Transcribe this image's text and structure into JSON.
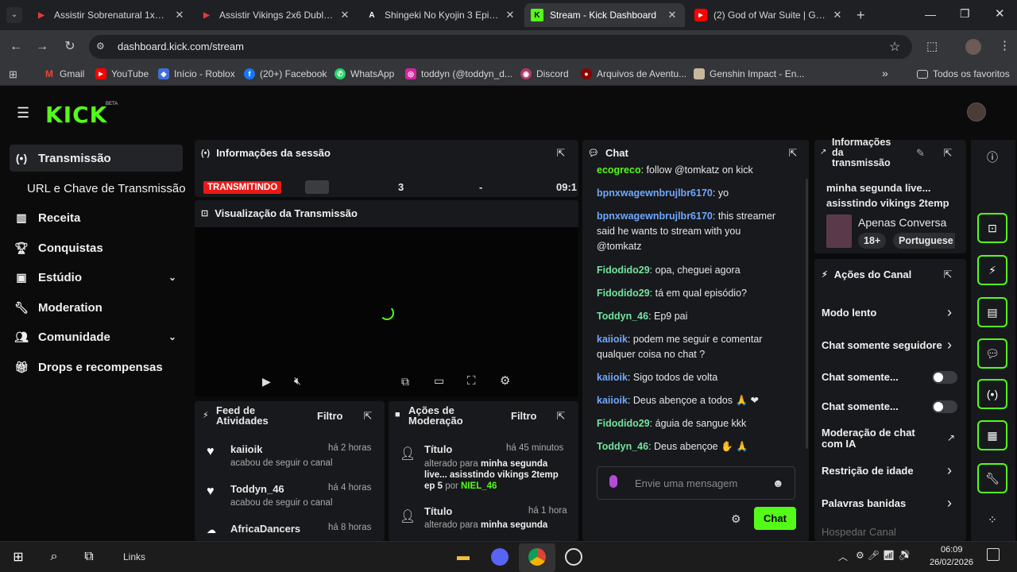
{
  "browser": {
    "tabs": [
      {
        "title": "Assistir Sobrenatural 1x10 Du",
        "favicon": "AS"
      },
      {
        "title": "Assistir Vikings 2x6 Dublado",
        "favicon": "AS"
      },
      {
        "title": "Shingeki No Kyojin 3 Episod",
        "favicon": "A"
      },
      {
        "title": "Stream - Kick Dashboard",
        "favicon": "K"
      },
      {
        "title": "(2) God of War Suite | God of",
        "favicon": "YT"
      }
    ],
    "new_tab": "+",
    "url": "dashboard.kick.com/stream",
    "bookmarks": [
      "Gmail",
      "YouTube",
      "Início - Roblox",
      "(20+) Facebook",
      "WhatsApp",
      "toddyn (@toddyn_d...",
      "Discord",
      "Arquivos de Aventu...",
      "Genshin Impact - En..."
    ],
    "bookmarks_overflow": "»",
    "all_favorites": "Todos os favoritos"
  },
  "kick": {
    "logo": "KICK",
    "beta": "BETA",
    "sidebar": [
      {
        "label": "Transmissão",
        "icon": "broadcast-icon"
      },
      {
        "label": "URL e Chave de Transmissão",
        "icon": ""
      },
      {
        "label": "Receita",
        "icon": "chart-icon"
      },
      {
        "label": "Conquistas",
        "icon": "trophy-icon"
      },
      {
        "label": "Estúdio",
        "icon": "studio-icon"
      },
      {
        "label": "Moderation",
        "icon": "wrench-icon"
      },
      {
        "label": "Comunidade",
        "icon": "community-icon"
      },
      {
        "label": "Drops e recompensas",
        "icon": "gift-icon"
      }
    ],
    "session": {
      "title": "Informações da sessão",
      "status": "TRANSMITINDO",
      "viewers": "3",
      "followers": "-",
      "time": "09:1"
    },
    "preview": {
      "title": "Visualização da Transmissão"
    },
    "feed": {
      "title": "Feed de Atividades",
      "filter": "Filtro",
      "items": [
        {
          "user": "kaiioik",
          "time": "há 2 horas",
          "desc": "acabou de seguir o canal"
        },
        {
          "user": "Toddyn_46",
          "time": "há 4 horas",
          "desc": "acabou de seguir o canal"
        },
        {
          "user": "AfricaDancers",
          "time": "há 8 horas",
          "desc": ""
        }
      ]
    },
    "moderation": {
      "title": "Ações de Moderação",
      "filter": "Filtro",
      "items": [
        {
          "title": "Título",
          "time": "há 45 minutos",
          "altered": "alterado para",
          "value": "minha segunda live... asisstindo vikings 2temp ep 5",
          "by": "por",
          "mod": "NIEL_46"
        },
        {
          "title": "Título",
          "time": "há 1 hora",
          "altered": "alterado para",
          "value": "minha segunda",
          "by": "",
          "mod": ""
        }
      ]
    },
    "chat": {
      "title": "Chat",
      "messages": [
        {
          "user": "ecogreco",
          "text": "follow @tomkatz on kick",
          "color": "#53fc18"
        },
        {
          "user": "bpnxwagewnbrujlbr6170",
          "text": "yo",
          "color": "#6fa8ff"
        },
        {
          "user": "bpnxwagewnbrujlbr6170",
          "text": "this streamer said he wants to stream with you @tomkatz",
          "color": "#6fa8ff"
        },
        {
          "user": "Fidodido29",
          "text": "opa, cheguei agora",
          "color": "#72e4a0"
        },
        {
          "user": "Fidodido29",
          "text": "tá em qual episódio?",
          "color": "#72e4a0"
        },
        {
          "user": "Toddyn_46",
          "text": "Ep9 pai",
          "color": "#72e4a0"
        },
        {
          "user": "kaiioik",
          "text": "podem me seguir e comentar qualquer coisa no chat ?",
          "color": "#6fa8ff"
        },
        {
          "user": "kaiioik",
          "text": "Sigo todos de volta",
          "color": "#6fa8ff"
        },
        {
          "user": "kaiioik",
          "text": "Deus abençoe a todos 🙏 ❤",
          "color": "#6fa8ff"
        },
        {
          "user": "Fidodido29",
          "text": "águia de sangue kkk",
          "color": "#72e4a0"
        },
        {
          "user": "Toddyn_46",
          "text": "Deus abençoe ✋ 🙏",
          "color": "#72e4a0"
        }
      ],
      "placeholder": "Envie uma mensagem",
      "send": "Chat"
    },
    "info": {
      "title": "Informações da transmissão",
      "stream_title": "minha segunda live... asisstindo vikings 2temp",
      "category": "Apenas Conversa",
      "age": "18+",
      "language": "Portuguese"
    },
    "actions": {
      "title": "Ações do Canal",
      "items": [
        {
          "label": "Modo lento",
          "control": "chevron"
        },
        {
          "label": "Chat somente seguidores",
          "control": "chevron"
        },
        {
          "label": "Chat somente...",
          "control": "toggle"
        },
        {
          "label": "Chat somente...",
          "control": "toggle"
        },
        {
          "label": "Moderação de chat com IA",
          "control": "external"
        },
        {
          "label": "Restrição de idade",
          "control": "chevron"
        },
        {
          "label": "Palavras banidas",
          "control": "chevron"
        },
        {
          "label": "Hospedar Canal",
          "control": "none"
        }
      ]
    }
  },
  "taskbar": {
    "links": "Links",
    "time": "06:09",
    "date": "26/02/2026"
  }
}
